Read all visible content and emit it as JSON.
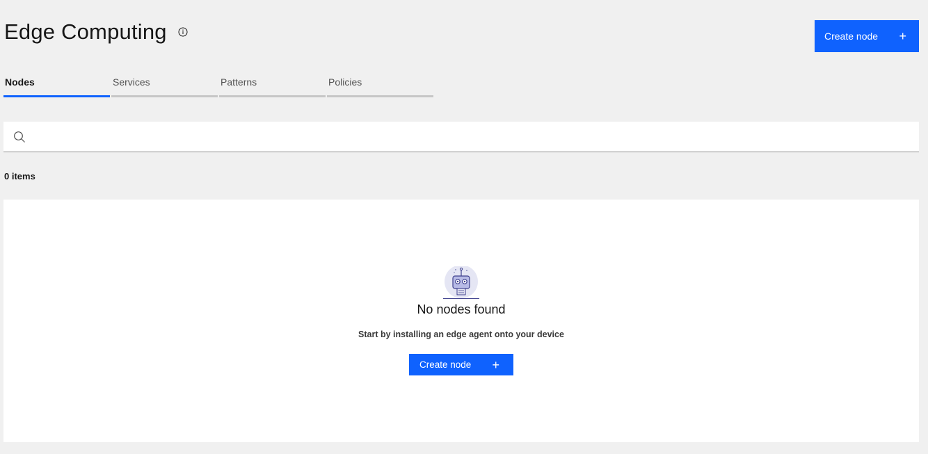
{
  "header": {
    "title": "Edge Computing",
    "create_label": "Create node",
    "plus": "+"
  },
  "tabs": [
    {
      "label": "Nodes",
      "active": true
    },
    {
      "label": "Services",
      "active": false
    },
    {
      "label": "Patterns",
      "active": false
    },
    {
      "label": "Policies",
      "active": false
    }
  ],
  "search": {
    "value": "",
    "placeholder": ""
  },
  "list": {
    "count_label": "0 items"
  },
  "empty_state": {
    "title": "No nodes found",
    "description": "Start by installing an edge agent onto your device",
    "button_label": "Create node",
    "plus": "+",
    "illustration": "robot-icon"
  },
  "colors": {
    "accent": "#0f62fe",
    "background": "#f0f0f0",
    "panel": "#ffffff"
  }
}
